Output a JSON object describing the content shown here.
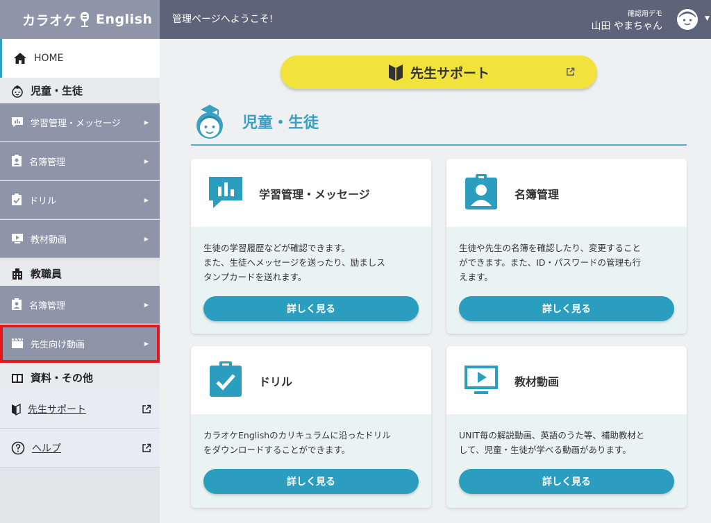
{
  "app": {
    "logo_left": "カラオケ",
    "logo_right": "English"
  },
  "header": {
    "welcome": "管理ページへようこそ!",
    "user_sub": "確認用デモ",
    "user_name": "山田 やまちゃん"
  },
  "sidebar": {
    "home": "HOME",
    "section_students": "児童・生徒",
    "student_items": [
      {
        "label": "学習管理・メッセージ"
      },
      {
        "label": "名簿管理"
      },
      {
        "label": "ドリル"
      },
      {
        "label": "教材動画"
      }
    ],
    "section_staff": "教職員",
    "staff_items": [
      {
        "label": "名簿管理"
      },
      {
        "label": "先生向け動画"
      }
    ],
    "section_materials": "資料・その他",
    "material_items": [
      {
        "label": "先生サポート"
      },
      {
        "label": "ヘルプ"
      }
    ]
  },
  "main": {
    "support_button": "先生サポート",
    "section_title": "児童・生徒",
    "cards": [
      {
        "title": "学習管理・メッセージ",
        "desc": "生徒の学習履歴などが確認できます。\nまた、生徒へメッセージを送ったり、励ましス\nタンプカードを送れます。",
        "button": "詳しく見る"
      },
      {
        "title": "名簿管理",
        "desc": "生徒や先生の名簿を確認したり、変更すること\nができます。また、ID・パスワードの管理も行\nえます。",
        "button": "詳しく見る"
      },
      {
        "title": "ドリル",
        "desc": "カラオケEnglishのカリキュラムに沿ったドリル\nをダウンロードすることができます。",
        "button": "詳しく見る"
      },
      {
        "title": "教材動画",
        "desc": "UNIT毎の解説動画、英語のうた等、補助教材と\nして、児童・生徒が学べる動画があります。",
        "button": "詳しく見る"
      }
    ]
  },
  "colors": {
    "accent": "#2b9ec0",
    "sidebar": "#8e95a9",
    "topbar": "#5d6378",
    "support": "#f2e33c",
    "highlight": "#e8141c"
  }
}
